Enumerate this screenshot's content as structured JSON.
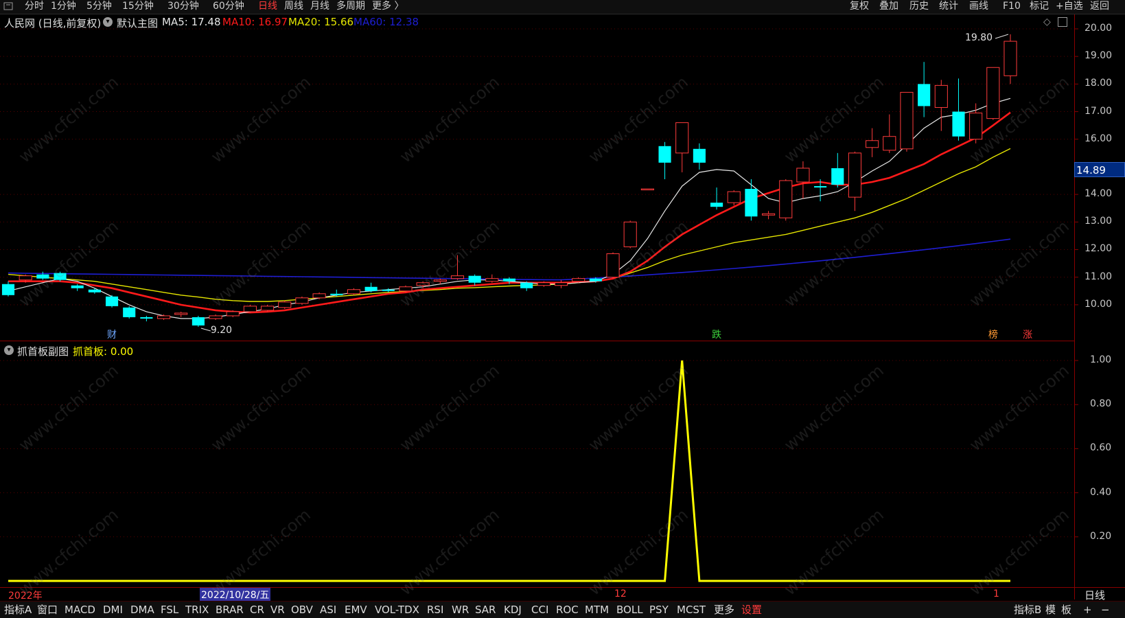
{
  "topbar": {
    "periods": [
      "分时",
      "1分钟",
      "5分钟",
      "15分钟",
      "30分钟",
      "60分钟",
      "日线",
      "周线",
      "月线",
      "多周期",
      "更多 〉"
    ],
    "active_period": "日线",
    "tools": [
      "复权",
      "叠加",
      "历史",
      "统计",
      "画线",
      "F10",
      "标记",
      "+自选",
      "返回"
    ]
  },
  "main_chart": {
    "stock_label": "人民网 (日线,前复权)",
    "template_label": "默认主图",
    "ma5": "MA5: 17.48",
    "ma10": "MA10: 16.97",
    "ma20": "MA20: 15.66",
    "ma60": "MA60: 12.38",
    "high_label": "19.80",
    "low_label": "9.20",
    "current_price": "14.89",
    "y_ticks": [
      "20.00",
      "19.00",
      "18.00",
      "17.00",
      "16.00",
      "14.00",
      "13.00",
      "12.00",
      "11.00",
      "10.00"
    ],
    "markers": [
      {
        "text": "财",
        "color": "#6fa8ff"
      },
      {
        "text": "跌",
        "color": "#3cd33c"
      },
      {
        "text": "榜",
        "color": "#ff9933"
      },
      {
        "text": "涨",
        "color": "#ff3b3b"
      }
    ],
    "colors": {
      "up": "#ff3b3b",
      "down": "#00ffff",
      "ma5": "#e6e6e6",
      "ma10": "#ff1a1a",
      "ma20": "#e6e600",
      "ma60": "#1e1ed2"
    }
  },
  "sub_chart": {
    "title": "抓首板副图",
    "value_label": "抓首板: 0.00",
    "y_ticks": [
      "1.00",
      "0.80",
      "0.60",
      "0.40",
      "0.20"
    ],
    "color": "#ffff00"
  },
  "time_axis": {
    "labels": [
      "2022年",
      "2022/10/28/五",
      "12",
      "1"
    ],
    "right_label": "日线"
  },
  "bottombar": {
    "tabs": [
      "指标A",
      "窗口",
      "MACD",
      "DMI",
      "DMA",
      "FSL",
      "TRIX",
      "BRAR",
      "CR",
      "VR",
      "OBV",
      "ASI",
      "EMV",
      "VOL-TDX",
      "RSI",
      "WR",
      "SAR",
      "KDJ",
      "CCI",
      "ROC",
      "MTM",
      "BOLL",
      "PSY",
      "MCST",
      "更多",
      "设置"
    ],
    "right_items": [
      "指标B",
      "模",
      "板",
      "+",
      "−"
    ]
  },
  "watermark": "www.cfchi.com",
  "chart_data": {
    "type": "candlestick",
    "candles": [
      [
        10.75,
        10.35,
        10.85,
        10.3
      ],
      [
        10.9,
        11.05,
        11.1,
        10.8
      ],
      [
        11.1,
        10.95,
        11.2,
        10.9
      ],
      [
        11.15,
        10.9,
        11.2,
        10.85
      ],
      [
        10.7,
        10.6,
        10.75,
        10.5
      ],
      [
        10.55,
        10.45,
        10.6,
        10.4
      ],
      [
        10.3,
        9.95,
        10.35,
        9.9
      ],
      [
        9.9,
        9.55,
        9.95,
        9.5
      ],
      [
        9.55,
        9.5,
        9.6,
        9.4
      ],
      [
        9.5,
        9.6,
        9.65,
        9.45
      ],
      [
        9.65,
        9.7,
        9.75,
        9.55
      ],
      [
        9.55,
        9.25,
        9.6,
        9.2
      ],
      [
        9.5,
        9.6,
        9.65,
        9.45
      ],
      [
        9.6,
        9.75,
        9.8,
        9.55
      ],
      [
        9.75,
        9.95,
        10.0,
        9.7
      ],
      [
        9.8,
        9.95,
        10.0,
        9.75
      ],
      [
        9.9,
        10.1,
        10.15,
        9.85
      ],
      [
        10.05,
        10.25,
        10.3,
        10.0
      ],
      [
        10.25,
        10.4,
        10.45,
        10.2
      ],
      [
        10.4,
        10.35,
        10.55,
        10.3
      ],
      [
        10.4,
        10.55,
        10.6,
        10.35
      ],
      [
        10.65,
        10.5,
        10.8,
        10.45
      ],
      [
        10.55,
        10.5,
        10.6,
        10.45
      ],
      [
        10.5,
        10.65,
        10.7,
        10.45
      ],
      [
        10.7,
        10.8,
        10.85,
        10.6
      ],
      [
        10.85,
        10.9,
        10.95,
        10.75
      ],
      [
        10.95,
        11.05,
        11.8,
        10.9
      ],
      [
        11.05,
        10.8,
        11.1,
        10.7
      ],
      [
        10.85,
        10.95,
        11.1,
        10.8
      ],
      [
        10.95,
        10.85,
        11.0,
        10.75
      ],
      [
        10.8,
        10.6,
        10.85,
        10.5
      ],
      [
        10.7,
        10.8,
        10.85,
        10.65
      ],
      [
        10.7,
        10.8,
        10.9,
        10.6
      ],
      [
        10.85,
        10.95,
        11.0,
        10.8
      ],
      [
        10.95,
        10.85,
        11.0,
        10.8
      ],
      [
        11.0,
        11.85,
        11.9,
        10.95
      ],
      [
        12.1,
        13.0,
        13.05,
        12.05
      ],
      [
        14.2,
        14.2,
        14.2,
        14.2
      ],
      [
        15.75,
        15.15,
        15.9,
        14.55
      ],
      [
        15.5,
        16.6,
        16.6,
        14.8
      ],
      [
        15.65,
        15.15,
        15.85,
        14.9
      ],
      [
        13.7,
        13.55,
        14.25,
        13.45
      ],
      [
        13.7,
        14.1,
        14.15,
        13.6
      ],
      [
        14.2,
        13.2,
        14.55,
        13.05
      ],
      [
        13.25,
        13.3,
        13.4,
        13.1
      ],
      [
        13.15,
        14.5,
        14.55,
        13.05
      ],
      [
        14.45,
        14.95,
        15.2,
        13.85
      ],
      [
        14.3,
        14.25,
        14.55,
        13.75
      ],
      [
        14.95,
        14.35,
        15.5,
        14.25
      ],
      [
        13.9,
        15.5,
        15.55,
        13.4
      ],
      [
        15.7,
        15.95,
        16.4,
        15.35
      ],
      [
        15.6,
        16.1,
        16.9,
        15.5
      ],
      [
        15.65,
        17.7,
        17.7,
        15.55
      ],
      [
        18.0,
        17.2,
        18.8,
        16.8
      ],
      [
        17.15,
        17.95,
        18.15,
        16.3
      ],
      [
        17.0,
        16.1,
        18.2,
        15.95
      ],
      [
        16.0,
        16.95,
        17.3,
        15.85
      ],
      [
        16.75,
        18.6,
        18.6,
        16.7
      ],
      [
        18.3,
        19.55,
        19.8,
        18.0
      ]
    ],
    "ma5": [
      10.5,
      10.65,
      10.8,
      10.95,
      10.85,
      10.6,
      10.3,
      10.0,
      9.75,
      9.6,
      9.5,
      9.5,
      9.55,
      9.65,
      9.75,
      9.85,
      10.0,
      10.1,
      10.25,
      10.35,
      10.45,
      10.5,
      10.55,
      10.6,
      10.65,
      10.75,
      10.85,
      10.9,
      10.9,
      10.85,
      10.8,
      10.75,
      10.75,
      10.8,
      10.85,
      11.1,
      11.6,
      12.4,
      13.4,
      14.3,
      14.8,
      14.9,
      14.85,
      14.35,
      13.85,
      13.7,
      13.85,
      13.95,
      14.1,
      14.45,
      14.85,
      15.2,
      15.8,
      16.4,
      16.8,
      16.9,
      17.05,
      17.3,
      17.48
    ],
    "ma10": [
      10.85,
      10.85,
      10.85,
      10.85,
      10.8,
      10.7,
      10.6,
      10.45,
      10.3,
      10.15,
      10.0,
      9.9,
      9.8,
      9.75,
      9.72,
      9.75,
      9.8,
      9.9,
      10.0,
      10.1,
      10.2,
      10.3,
      10.4,
      10.45,
      10.55,
      10.6,
      10.65,
      10.7,
      10.75,
      10.8,
      10.8,
      10.8,
      10.8,
      10.82,
      10.85,
      10.95,
      11.2,
      11.6,
      12.1,
      12.55,
      12.9,
      13.25,
      13.55,
      13.85,
      14.05,
      14.25,
      14.4,
      14.45,
      14.35,
      14.35,
      14.45,
      14.6,
      14.85,
      15.1,
      15.45,
      15.75,
      16.05,
      16.5,
      16.97
    ],
    "ma20": [
      11.1,
      11.05,
      11.0,
      10.95,
      10.9,
      10.85,
      10.75,
      10.65,
      10.55,
      10.45,
      10.35,
      10.28,
      10.2,
      10.15,
      10.12,
      10.12,
      10.15,
      10.2,
      10.25,
      10.3,
      10.35,
      10.4,
      10.45,
      10.48,
      10.52,
      10.55,
      10.6,
      10.62,
      10.65,
      10.68,
      10.7,
      10.72,
      10.75,
      10.8,
      10.85,
      10.95,
      11.15,
      11.35,
      11.6,
      11.8,
      11.95,
      12.1,
      12.25,
      12.35,
      12.45,
      12.55,
      12.7,
      12.85,
      13.0,
      13.15,
      13.35,
      13.6,
      13.85,
      14.15,
      14.45,
      14.75,
      15.0,
      15.35,
      15.66
    ],
    "ma60_x_start": 0,
    "ma60_start": 11.15,
    "ma60_mid": 10.9,
    "ma60_end": 12.38,
    "sub_indicator_pulse_index": 39,
    "y_range_main": [
      9.2,
      20.0
    ],
    "y_range_sub": [
      0,
      1.0
    ]
  }
}
